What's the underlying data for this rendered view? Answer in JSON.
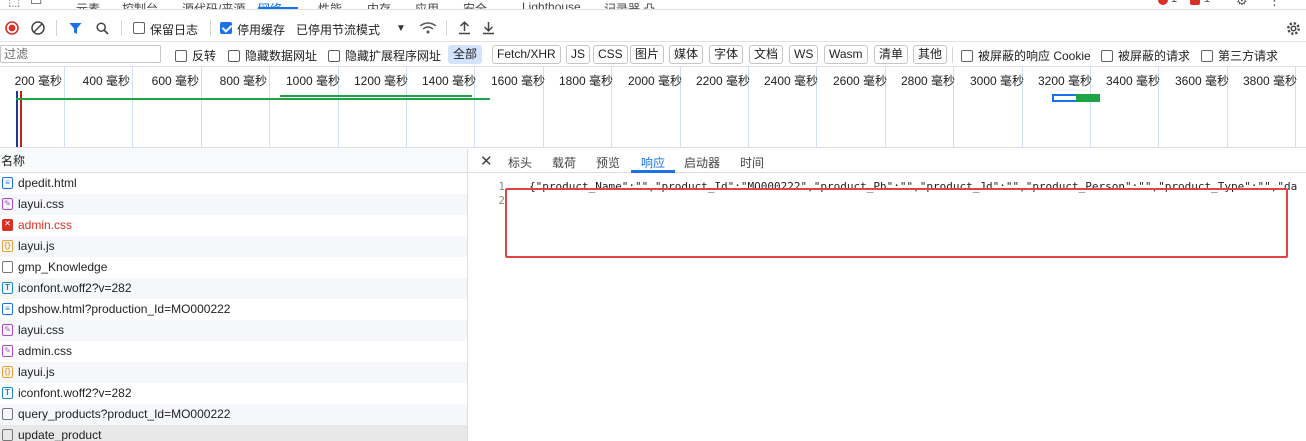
{
  "tabstrip": {
    "tabs": [
      "元素",
      "控制台",
      "源代码/来源",
      "网络",
      "性能",
      "内存",
      "应用",
      "安全",
      "Lighthouse",
      "记录器 凸"
    ],
    "active": "网络",
    "errors_count": "1",
    "issues_count": "1"
  },
  "toolbar1": {
    "preserve_log_label": "保留日志",
    "disable_cache_label": "停用缓存",
    "throttle_value": "已停用节流模式"
  },
  "toolbar2": {
    "filter_placeholder": "过滤",
    "invert_label": "反转",
    "hide_data_urls_label": "隐藏数据网址",
    "hide_ext_urls_label": "隐藏扩展程序网址",
    "types": [
      "全部",
      "Fetch/XHR",
      "JS",
      "CSS",
      "图片",
      "媒体",
      "字体",
      "文档",
      "WS",
      "Wasm",
      "清单",
      "其他"
    ],
    "active_type": "全部",
    "blocked_cookies_label": "被屏蔽的响应 Cookie",
    "blocked_requests_label": "被屏蔽的请求",
    "third_party_label": "第三方请求"
  },
  "timeline": {
    "ticks": [
      "200 毫秒",
      "400 毫秒",
      "600 毫秒",
      "800 毫秒",
      "1000 毫秒",
      "1200 毫秒",
      "1400 毫秒",
      "1600 毫秒",
      "1800 毫秒",
      "2000 毫秒",
      "2200 毫秒",
      "2400 毫秒",
      "2600 毫秒",
      "2800 毫秒",
      "3000 毫秒",
      "3200 毫秒",
      "3400 毫秒",
      "3600 毫秒",
      "3800 毫秒"
    ],
    "colors": {
      "green": "#1ea446",
      "blue": "#1a73e8",
      "red": "#c5221f",
      "navy": "#1d3a8a"
    }
  },
  "request_list": {
    "header": "名称",
    "rows": [
      {
        "name": "dpedit.html",
        "icon": "document-icon",
        "type": "doc"
      },
      {
        "name": "layui.css",
        "icon": "stylesheet-icon",
        "type": "css"
      },
      {
        "name": "admin.css",
        "icon": "error-icon",
        "type": "err"
      },
      {
        "name": "layui.js",
        "icon": "script-icon",
        "type": "js"
      },
      {
        "name": "gmp_Knowledge",
        "icon": "plain-file-icon",
        "type": "plain"
      },
      {
        "name": "iconfont.woff2?v=282",
        "icon": "font-icon",
        "type": "font"
      },
      {
        "name": "dpshow.html?production_Id=MO000222",
        "icon": "document-icon",
        "type": "doc"
      },
      {
        "name": "layui.css",
        "icon": "stylesheet-icon",
        "type": "css"
      },
      {
        "name": "admin.css",
        "icon": "stylesheet-icon",
        "type": "css"
      },
      {
        "name": "layui.js",
        "icon": "script-icon",
        "type": "js"
      },
      {
        "name": "iconfont.woff2?v=282",
        "icon": "font-icon",
        "type": "font"
      },
      {
        "name": "query_products?product_Id=MO000222",
        "icon": "plain-file-icon",
        "type": "plain"
      },
      {
        "name": "update_product",
        "icon": "plain-file-icon",
        "type": "plain"
      }
    ]
  },
  "detail": {
    "tabs": [
      "标头",
      "载荷",
      "预览",
      "响应",
      "启动器",
      "时间"
    ],
    "active_tab": "响应",
    "line_numbers": [
      "1",
      "2"
    ],
    "response_line": "{\"product_Name\":\"\",\"product_Id\":\"MO000222\",\"product_Ph\":\"\",\"product_Jd\":\"\",\"product_Person\":\"\",\"product_Type\":\"\",\"da"
  }
}
